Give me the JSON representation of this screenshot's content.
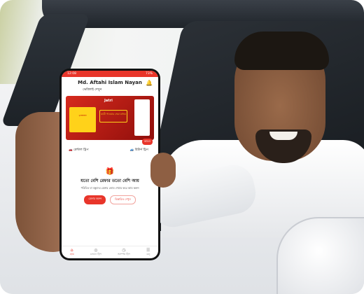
{
  "phone": {
    "status_time": "12:08",
    "status_right": "73%",
    "user_name": "Md. Aftahi Islam Nayan",
    "user_sub": "ভেরিফাই দেখুন",
    "banner": {
      "logo": "Jatri",
      "card_text": "১০০০০",
      "mid_text": "যাত্রী পাওয়ার সেরা মাধ্যম"
    },
    "more_badge": "আরও",
    "trips": [
      {
        "icon": "car-icon",
        "label": "রেন্টাল ট্রিপ"
      },
      {
        "icon": "return-car-icon",
        "label": "রিটার্ন ট্রিপ"
      }
    ],
    "referral": {
      "title": "যতো বেশি রেফার ততো বেশি আয়",
      "subtitle": "পরিচিত বা বন্ধুদের রেফার কোড শেয়ার করে আয় করুন",
      "primary_button": "রেফার করুন",
      "secondary_button": "বিস্তারিত দেখুন"
    },
    "nav": [
      {
        "icon": "home-icon",
        "label": "হোম",
        "active": true
      },
      {
        "icon": "location-icon",
        "label": "চলমান ট্রিপ"
      },
      {
        "icon": "clock-icon",
        "label": "অসম্পন্ন ট্রিপ"
      },
      {
        "icon": "menu-icon",
        "label": "মেনু"
      }
    ],
    "accent": "#e8352a"
  }
}
